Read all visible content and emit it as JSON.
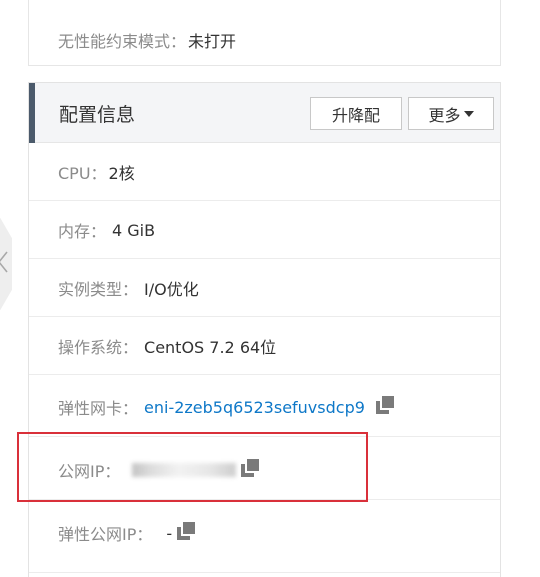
{
  "top_row": {
    "label": "无性能约束模式：",
    "value": "未打开"
  },
  "config": {
    "title": "配置信息",
    "upgrade_label": "升降配",
    "more_label": "更多"
  },
  "rows": {
    "cpu": {
      "label": "CPU：",
      "value": "2核"
    },
    "memory": {
      "label": "内存：",
      "value": "4 GiB"
    },
    "instance_type": {
      "label": "实例类型：",
      "value": "I/O优化"
    },
    "os": {
      "label": "操作系统：",
      "value": "CentOS 7.2 64位"
    },
    "eni": {
      "label": "弹性网卡：",
      "value": "eni-2zeb5q6523sefuvsdcp9"
    },
    "public_ip": {
      "label": "公网IP：",
      "value": ""
    },
    "eip": {
      "label": "弹性公网IP：",
      "value": "-"
    }
  },
  "colors": {
    "link": "#0e78c8",
    "highlight": "#d9303a",
    "header_bg": "#f4f5f7",
    "accent_bar": "#4b5a6b"
  },
  "icons": {
    "copy": "copy-icon",
    "collapse": "chevron-left-icon",
    "dropdown": "caret-down-icon"
  }
}
